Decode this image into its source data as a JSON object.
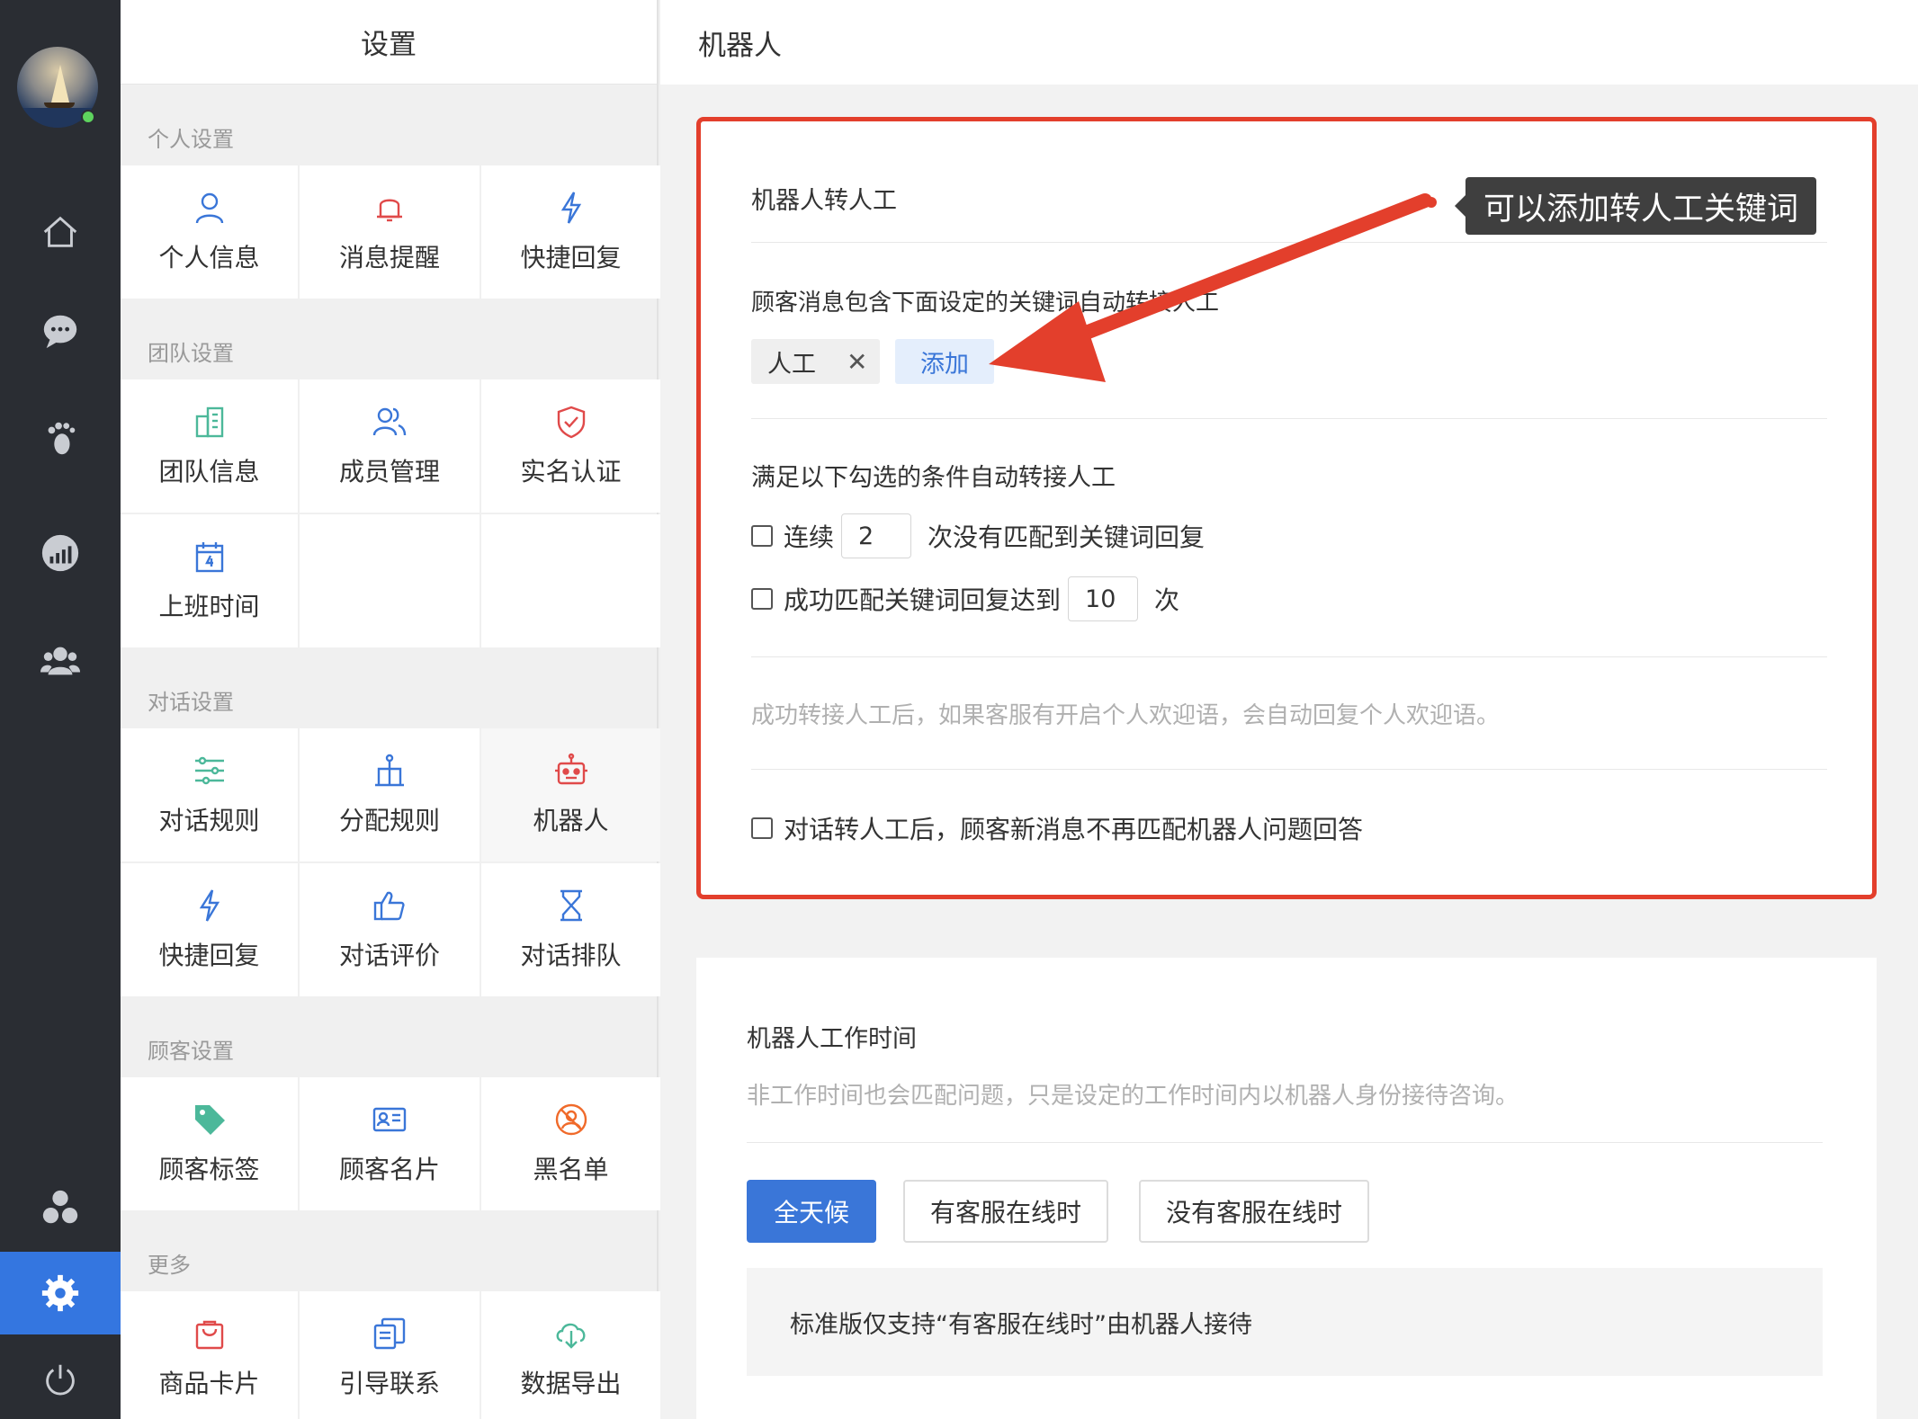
{
  "colors": {
    "accent": "#3a76d8",
    "highlight_border": "#e33f2c",
    "rail_bg": "#2a2d33",
    "online": "#5ed35e"
  },
  "rail": {
    "icons": [
      "avatar",
      "home-icon",
      "chat-icon",
      "footprint-icon",
      "analytics-icon",
      "team-icon",
      "apps-icon",
      "settings-icon",
      "power-icon"
    ],
    "active": "settings-icon"
  },
  "settings": {
    "title": "设置",
    "groups": [
      {
        "title": "个人设置",
        "items": [
          {
            "label": "个人信息",
            "icon": "user-icon"
          },
          {
            "label": "消息提醒",
            "icon": "bell-icon"
          },
          {
            "label": "快捷回复",
            "icon": "lightning-icon"
          }
        ]
      },
      {
        "title": "团队设置",
        "items": [
          {
            "label": "团队信息",
            "icon": "building-icon"
          },
          {
            "label": "成员管理",
            "icon": "members-icon"
          },
          {
            "label": "实名认证",
            "icon": "shield-check-icon"
          },
          {
            "label": "上班时间",
            "icon": "calendar-icon"
          }
        ]
      },
      {
        "title": "对话设置",
        "items": [
          {
            "label": "对话规则",
            "icon": "sliders-icon"
          },
          {
            "label": "分配规则",
            "icon": "distribute-icon"
          },
          {
            "label": "机器人",
            "icon": "robot-icon"
          },
          {
            "label": "快捷回复",
            "icon": "lightning-icon"
          },
          {
            "label": "对话评价",
            "icon": "thumbs-up-icon"
          },
          {
            "label": "对话排队",
            "icon": "hourglass-icon"
          }
        ]
      },
      {
        "title": "顾客设置",
        "items": [
          {
            "label": "顾客标签",
            "icon": "tag-icon"
          },
          {
            "label": "顾客名片",
            "icon": "id-card-icon"
          },
          {
            "label": "黑名单",
            "icon": "blocked-user-icon"
          }
        ]
      },
      {
        "title": "更多",
        "items": [
          {
            "label": "商品卡片",
            "icon": "shopping-bag-icon"
          },
          {
            "label": "引导联系",
            "icon": "documents-icon"
          },
          {
            "label": "数据导出",
            "icon": "cloud-download-icon"
          }
        ]
      }
    ],
    "selected": "机器人"
  },
  "main": {
    "title": "机器人",
    "handoff": {
      "title": "机器人转人工",
      "tooltip": "可以添加转人工关键词",
      "keyword_hint": "顾客消息包含下面设定的关键词自动转接人工",
      "keywords": [
        "人工"
      ],
      "remove_glyph": "✕",
      "add_label": "添加",
      "conditions_title": "满足以下勾选的条件自动转接人工",
      "cond1": {
        "prefix": "连续",
        "value": "2",
        "suffix": "次没有匹配到关键词回复",
        "checked": false
      },
      "cond2": {
        "prefix": "成功匹配关键词回复达到",
        "value": "10",
        "suffix": "次",
        "checked": false
      },
      "welcome_hint": "成功转接人工后，如果客服有开启个人欢迎语，会自动回复个人欢迎语。",
      "no_match_option": {
        "label": "对话转人工后，顾客新消息不再匹配机器人问题回答",
        "checked": false
      }
    },
    "worktime": {
      "title": "机器人工作时间",
      "hint": "非工作时间也会匹配问题，只是设定的工作时间内以机器人身份接待咨询。",
      "options": [
        "全天候",
        "有客服在线时",
        "没有客服在线时"
      ],
      "selected": "全天候",
      "notice": "标准版仅支持“有客服在线时”由机器人接待"
    }
  }
}
